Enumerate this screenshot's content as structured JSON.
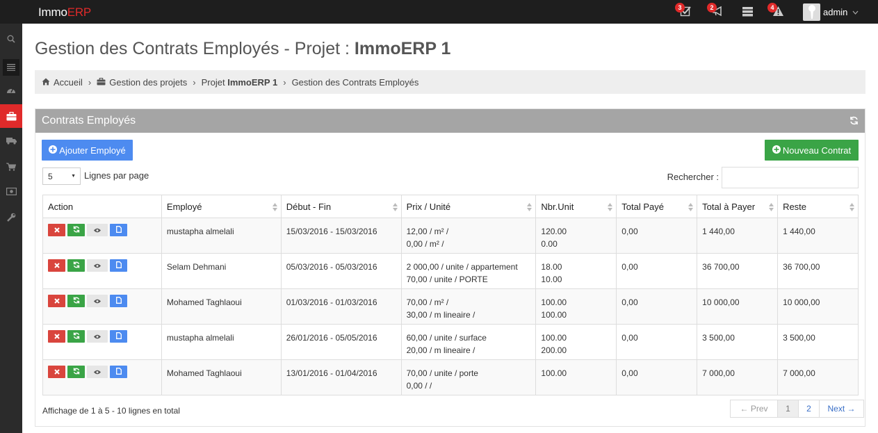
{
  "app": {
    "logo_prefix": "Immo",
    "logo_suffix": "ERP",
    "accent": "#e02a2a"
  },
  "topbar": {
    "notifications": [
      {
        "icon": "tasks-icon",
        "count": "3"
      },
      {
        "icon": "bullhorn-icon",
        "count": "2"
      },
      {
        "icon": "server-icon",
        "count": ""
      },
      {
        "icon": "warning-icon",
        "count": "4"
      }
    ],
    "username": "admin"
  },
  "sidebar": {
    "items": [
      "search-icon",
      "menu-icon",
      "dashboard-icon",
      "briefcase-icon",
      "truck-icon",
      "cart-icon",
      "money-icon",
      "wrench-icon"
    ]
  },
  "page": {
    "title_prefix": "Gestion des Contrats Employés - Projet : ",
    "title_strong": "ImmoERP 1"
  },
  "breadcrumb": {
    "home": "Accueil",
    "projects": "Gestion des projets",
    "project_prefix": "Projet ",
    "project_name": "ImmoERP 1",
    "current": "Gestion des Contrats Employés"
  },
  "panel": {
    "title": "Contrats Employés",
    "add_employee": "Ajouter Employé",
    "new_contract": "Nouveau Contrat",
    "page_size": "5",
    "lines_per_page": "Lignes par page",
    "search_label": "Rechercher :",
    "search_value": ""
  },
  "table": {
    "headers": [
      "Action",
      "Employé",
      "Début - Fin",
      "Prix / Unité",
      "Nbr.Unit",
      "Total Payé",
      "Total à Payer",
      "Reste"
    ],
    "rows": [
      {
        "employe": "mustapha almelali",
        "periode": "15/03/2016 - 15/03/2016",
        "prix1": "12,00 / m² /",
        "prix2": "0,00 / m² /",
        "nbr1": "120.00",
        "nbr2": "0.00",
        "paye": "0,00",
        "total": "1 440,00",
        "reste": "1 440,00"
      },
      {
        "employe": "Selam Dehmani",
        "periode": "05/03/2016 - 05/03/2016",
        "prix1": "2 000,00 / unite / appartement",
        "prix2": "70,00 / unite / PORTE",
        "nbr1": "18.00",
        "nbr2": "10.00",
        "paye": "0,00",
        "total": "36 700,00",
        "reste": "36 700,00"
      },
      {
        "employe": "Mohamed Taghlaoui",
        "periode": "01/03/2016 - 01/03/2016",
        "prix1": "70,00 / m² /",
        "prix2": "30,00 / m lineaire /",
        "nbr1": "100.00",
        "nbr2": "100.00",
        "paye": "0,00",
        "total": "10 000,00",
        "reste": "10 000,00"
      },
      {
        "employe": "mustapha almelali",
        "periode": "26/01/2016 - 05/05/2016",
        "prix1": "60,00 / unite / surface",
        "prix2": "20,00 / m lineaire /",
        "nbr1": "100.00",
        "nbr2": "200.00",
        "paye": "0,00",
        "total": "3 500,00",
        "reste": "3 500,00"
      },
      {
        "employe": "Mohamed Taghlaoui",
        "periode": "13/01/2016 - 01/04/2016",
        "prix1": "70,00 / unite / porte",
        "prix2": "0,00 /  /",
        "nbr1": "100.00",
        "nbr2": "",
        "paye": "0,00",
        "total": "7 000,00",
        "reste": "7 000,00"
      }
    ]
  },
  "footer": {
    "info": "Affichage de 1 à 5 - 10 lignes en total",
    "prev": "← Prev",
    "pages": [
      "1",
      "2"
    ],
    "next": "Next →"
  }
}
